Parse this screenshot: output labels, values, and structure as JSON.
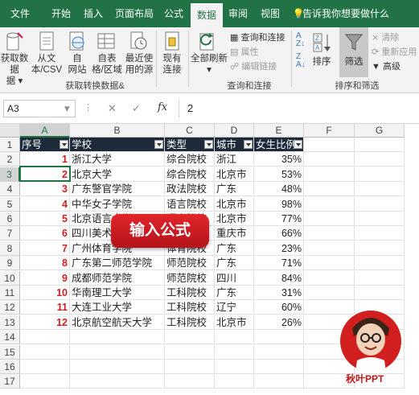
{
  "ribbon_tabs": [
    "文件",
    "开始",
    "插入",
    "页面布局",
    "公式",
    "数据",
    "审阅",
    "视图"
  ],
  "active_tab": "数据",
  "tell_me": "告诉我你想要做什么",
  "ribbon": {
    "get_data": "获取数据",
    "get_data_2": "据 ▾",
    "from_csv_1": "从文",
    "from_csv_2": "本/CSV",
    "from_web_1": "自",
    "from_web_2": "网站",
    "from_table_1": "自表",
    "from_table_2": "格/区域",
    "recent_1": "最近使",
    "recent_2": "用的源",
    "existing_1": "现有",
    "existing_2": "连接",
    "group_get": "获取转换数据&",
    "refresh_all": "全部刷新",
    "queries": "查询和连接",
    "properties": "属性",
    "edit_links": "编辑链接",
    "group_queries": "查询和连接",
    "sort": "排序",
    "filter": "筛选",
    "clear": "清除",
    "reapply": "重新应用",
    "advanced": "高级",
    "group_sort": "排序和筛选"
  },
  "formula_bar": {
    "name_box": "A3",
    "fx": "fx",
    "value": "2"
  },
  "columns": [
    "A",
    "B",
    "C",
    "D",
    "E",
    "F",
    "G"
  ],
  "selected_col": "A",
  "rows": [
    "1",
    "2",
    "3",
    "4",
    "5",
    "6",
    "7",
    "8",
    "9",
    "10",
    "11",
    "12",
    "13",
    "14",
    "15",
    "16",
    "17"
  ],
  "selected_row": "3",
  "table": {
    "headers": [
      "序号",
      "学校",
      "类型",
      "城市",
      "女生比例"
    ],
    "rows": [
      [
        "1",
        "浙江大学",
        "综合院校",
        "浙江",
        "35%"
      ],
      [
        "2",
        "北京大学",
        "综合院校",
        "北京市",
        "53%"
      ],
      [
        "3",
        "广东警官学院",
        "政法院校",
        "广东",
        "48%"
      ],
      [
        "4",
        "中华女子学院",
        "语言院校",
        "北京市",
        "98%"
      ],
      [
        "5",
        "北京语言大学",
        "语言院校",
        "北京市",
        "77%"
      ],
      [
        "6",
        "四川美术学院",
        "艺术院校",
        "重庆市",
        "66%"
      ],
      [
        "7",
        "广州体育学院",
        "体育院校",
        "广东",
        "23%"
      ],
      [
        "8",
        "广东第二师范学院",
        "师范院校",
        "广东",
        "71%"
      ],
      [
        "9",
        "成都师范学院",
        "师范院校",
        "四川",
        "84%"
      ],
      [
        "10",
        "华南理工大学",
        "工科院校",
        "广东",
        "31%"
      ],
      [
        "11",
        "大连工业大学",
        "工科院校",
        "辽宁",
        "60%"
      ],
      [
        "12",
        "北京航空航天大学",
        "工科院校",
        "北京市",
        "26%"
      ]
    ]
  },
  "overlay_badge": "输入公式",
  "brand": "秋叶PPT",
  "colors": {
    "excel_green": "#217346",
    "header_fill": "#1d2a3a",
    "index_red": "#d11f1f",
    "badge_red": "#d11f1f"
  }
}
